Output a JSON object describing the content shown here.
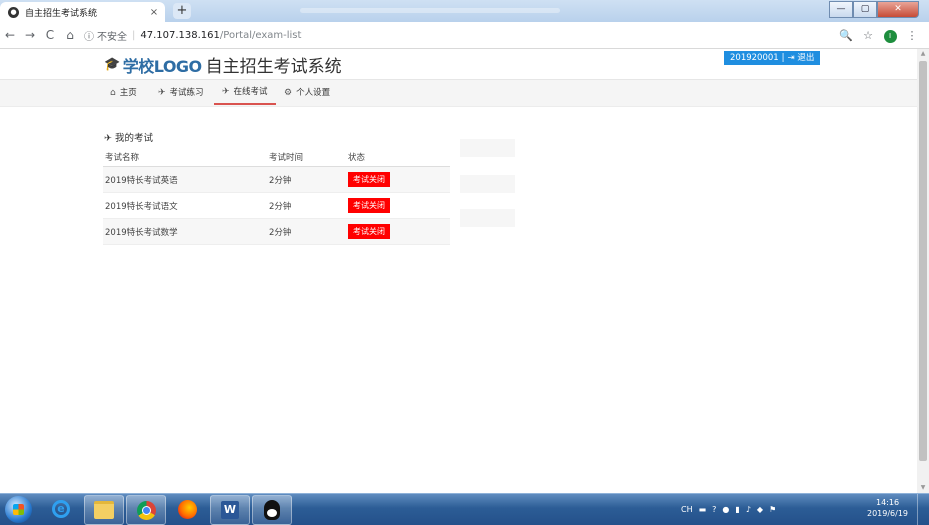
{
  "browser": {
    "tab_title": "自主招生考试系统",
    "tab_close": "×",
    "new_tab": "+",
    "window_min": "—",
    "window_max": "▢",
    "window_close": "✕",
    "nav_back": "←",
    "nav_forward": "→",
    "nav_reload": "C",
    "nav_home": "⌂",
    "security_icon": "ⓘ",
    "security_label": "不安全",
    "url_separator": "|",
    "url_host": "47.107.138.161",
    "url_path": "/Portal/exam-list",
    "zoom_icon": "🔍",
    "bookmark_icon": "☆",
    "profile_initial": "I",
    "menu_icon": "⋮"
  },
  "header": {
    "logo_icon": "graduation-cap-icon",
    "logo_cap": "🎓",
    "logo_text": "学校LOGO",
    "system_name": "自主招生考试系统",
    "user_id": "201920001",
    "user_sep": "|",
    "logout_icon": "⇥",
    "logout_label": "退出"
  },
  "nav": {
    "items": [
      {
        "icon": "⌂",
        "label": "主页"
      },
      {
        "icon": "✈",
        "label": "考试练习"
      },
      {
        "icon": "✈",
        "label": "在线考试"
      },
      {
        "icon": "⚙",
        "label": "个人设置"
      }
    ],
    "active_index": 2,
    "active_color": "#d9534f"
  },
  "section": {
    "icon": "✈",
    "title": "我的考试"
  },
  "table": {
    "headers": [
      "考试名称",
      "考试时间",
      "状态"
    ],
    "rows": [
      {
        "name": "2019特长考试英语",
        "time": "2分钟",
        "status": "考试关闭"
      },
      {
        "name": "2019特长考试语文",
        "time": "2分钟",
        "status": "考试关闭"
      },
      {
        "name": "2019特长考试数学",
        "time": "2分钟",
        "status": "考试关闭"
      }
    ],
    "status_color": "#ff0000"
  },
  "taskbar": {
    "ie_letter": "e",
    "word_letter": "W",
    "tray": {
      "lang": "CH",
      "icons": [
        "keyboard-icon",
        "help-icon",
        "chat-icon",
        "network-icon",
        "volume-icon",
        "shield-icon",
        "flag-icon"
      ]
    },
    "clock_time": "14:16",
    "clock_date": "2019/6/19"
  }
}
